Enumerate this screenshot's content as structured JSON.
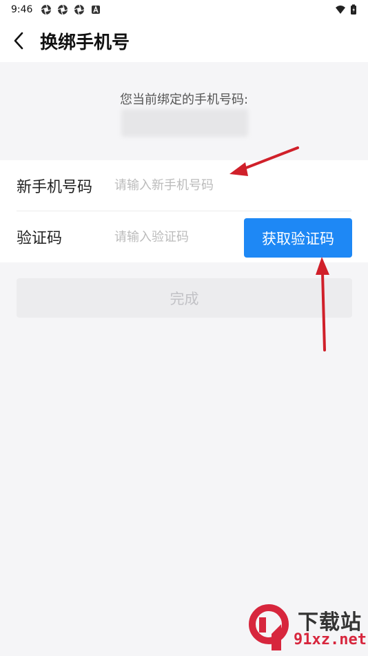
{
  "status_bar": {
    "time": "9:46",
    "left_icons": [
      "aperture-icon",
      "aperture-icon",
      "aperture-icon",
      "a-notification-icon"
    ],
    "right_icons": [
      "wifi-icon",
      "battery-icon"
    ]
  },
  "header": {
    "back_icon": "chevron-left-icon",
    "title": "换绑手机号"
  },
  "current": {
    "label": "您当前绑定的手机号码:",
    "value_blurred": true
  },
  "form": {
    "phone_label": "新手机号码",
    "phone_placeholder": "请输入新手机号码",
    "phone_value": "",
    "code_label": "验证码",
    "code_placeholder": "请输入验证码",
    "code_value": "",
    "get_code_label": "获取验证码"
  },
  "done_label": "完成",
  "watermark": {
    "top": "下载站",
    "bottom": "91xz.net",
    "logo_text": "9"
  },
  "colors": {
    "accent": "#1e88f5",
    "annotation_arrow": "#d0202a",
    "background": "#f5f5f7"
  }
}
